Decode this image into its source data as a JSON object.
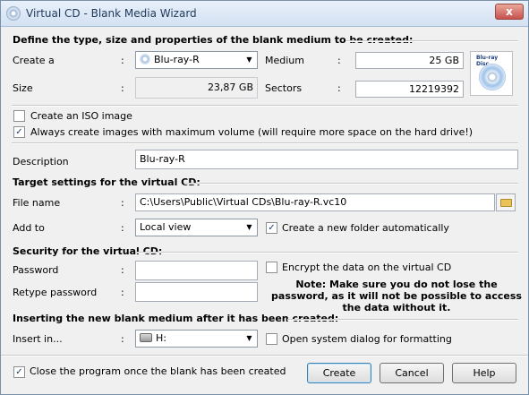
{
  "window": {
    "title": "Virtual CD - Blank Media Wizard",
    "close_glyph": "x"
  },
  "section_blank": {
    "heading": "Define the type, size and properties of the blank medium to be created:"
  },
  "create_a": {
    "label": "Create a",
    "colon": ":",
    "value": "Blu-ray-R"
  },
  "medium": {
    "label": "Medium",
    "colon": ":",
    "value": "25 GB"
  },
  "size": {
    "label": "Size",
    "colon": ":",
    "value": "23,87 GB"
  },
  "sectors": {
    "label": "Sectors",
    "colon": ":",
    "value": "12219392"
  },
  "iso": {
    "label": "Create an ISO image",
    "checked": false
  },
  "max_volume": {
    "label": "Always create images with maximum volume (will require more space on the hard drive!)",
    "checked": true
  },
  "description": {
    "label": "Description",
    "value": "Blu-ray-R"
  },
  "section_target": {
    "heading": "Target settings for the virtual CD:"
  },
  "file_name": {
    "label": "File name",
    "colon": ":",
    "value": "C:\\Users\\Public\\Virtual CDs\\Blu-ray-R.vc10"
  },
  "add_to": {
    "label": "Add to",
    "colon": ":",
    "value": "Local view"
  },
  "new_folder": {
    "label": "Create a new folder automatically",
    "checked": true
  },
  "section_security": {
    "heading": "Security for the virtual CD:"
  },
  "password": {
    "label": "Password",
    "colon": ":",
    "value": ""
  },
  "retype_password": {
    "label": "Retype password",
    "colon": ":",
    "value": ""
  },
  "encrypt": {
    "label": "Encrypt the data on the virtual CD",
    "checked": false
  },
  "note": {
    "text": "Note: Make sure you do not lose the password, as it will not be possible to access the data without it."
  },
  "section_insert": {
    "heading": "Inserting the new blank medium after it has been created:"
  },
  "insert_in": {
    "label": "Insert in...",
    "colon": ":",
    "value": "H:"
  },
  "format_dialog": {
    "label": "Open system dialog for formatting",
    "checked": false
  },
  "close_program": {
    "label": "Close the program once the blank has been created",
    "checked": true
  },
  "buttons": {
    "create": "Create",
    "cancel": "Cancel",
    "help": "Help"
  },
  "disc_logo": "Blu-ray Disc",
  "icons": {
    "app": "cd-disc-icon",
    "medium": "blu-ray-disc-icon",
    "folder": "folder-open-icon",
    "drive": "drive-icon"
  }
}
